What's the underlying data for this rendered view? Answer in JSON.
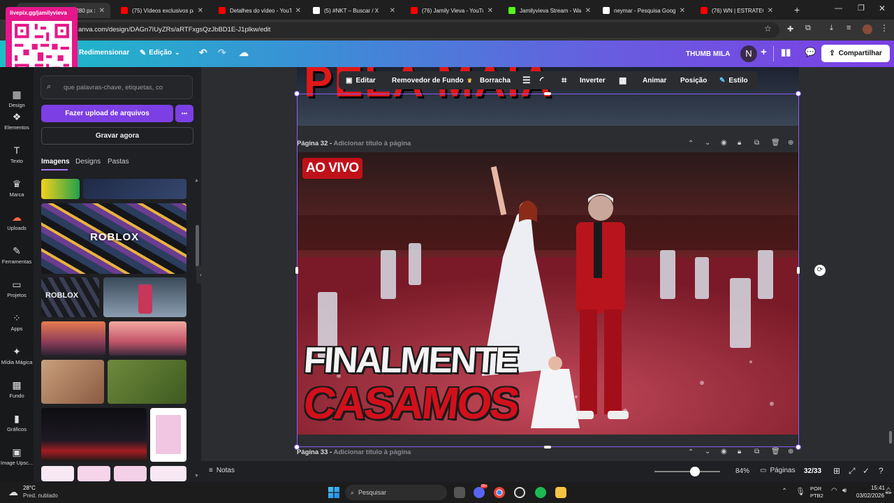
{
  "browser": {
    "tabs": [
      {
        "label": "THUMB MILA - 1280 px x",
        "color": "#3aa0ff"
      },
      {
        "label": "(75) Vídeos exclusivos par",
        "color": "#ff0000"
      },
      {
        "label": "Detalhes do vídeo - YouTu",
        "color": "#ff0000"
      },
      {
        "label": "(5) #NKT – Buscar / X",
        "color": "#ffffff"
      },
      {
        "label": "(76) Jamily Vieva - YouTu",
        "color": "#ff0000"
      },
      {
        "label": "Jamilyvieva Stream - Wat",
        "color": "#53fc18"
      },
      {
        "label": "neymar - Pesquisa Googl",
        "color": "#ffffff"
      },
      {
        "label": "(76) WN | ESTRATEGIA AL",
        "color": "#ff0000"
      }
    ],
    "url": "anva.com/design/DAGn7IUyZRs/aRTFxgsQzJbBD1E-J1plkw/edit"
  },
  "overlay": {
    "qr_label": "livepix.gg/jamilyvieva"
  },
  "header": {
    "resize": "Redimensionar",
    "edit": "Edição",
    "design_name": "THUMB MILA",
    "avatar_letter": "N",
    "share": "Compartilhar"
  },
  "rail": {
    "items": [
      {
        "label": "Design",
        "icon": "▦"
      },
      {
        "label": "Elementos",
        "icon": "❖"
      },
      {
        "label": "Texto",
        "icon": "T"
      },
      {
        "label": "Marca",
        "icon": "♛"
      },
      {
        "label": "Uploads",
        "icon": "☁"
      },
      {
        "label": "Ferramentas",
        "icon": "✎"
      },
      {
        "label": "Projetos",
        "icon": "▭"
      },
      {
        "label": "Apps",
        "icon": "⁘"
      },
      {
        "label": "Mídia Mágica",
        "icon": "✦"
      },
      {
        "label": "Fundo",
        "icon": "▩"
      },
      {
        "label": "Gráficos",
        "icon": "▮"
      },
      {
        "label": "Image Upsc...",
        "icon": "▣"
      }
    ]
  },
  "panel": {
    "search_placeholder": "que palavras-chave, etiquetas, co",
    "upload": "Fazer upload de arquivos",
    "more": "•••",
    "record": "Gravar agora",
    "tabs": [
      "Imagens",
      "Designs",
      "Pastas"
    ],
    "roblox": "ROBLOX"
  },
  "context_toolbar": {
    "edit": "Editar",
    "bg_remover": "Removedor de Fundo",
    "eraser": "Borracha",
    "flip": "Inverter",
    "animate": "Animar",
    "position": "Posição",
    "style": "Estilo"
  },
  "pages": {
    "p32_label": "Página 32 - ",
    "p32_title_placeholder": "Adicionar título à página",
    "p33_label": "Página 33 - ",
    "p33_title_placeholder": "Adicionar título à página"
  },
  "thumbnail": {
    "live_badge": "AO VIVO",
    "line1": "FINALMENTE",
    "line2": "CASAMOS",
    "prev_page_text": "PELA MAIA"
  },
  "bottom": {
    "notes": "Notas",
    "zoom": "84%",
    "pages": "Páginas",
    "page_count": "32/33",
    "zoom_fraction": 0.62
  },
  "taskbar": {
    "temp": "28°C",
    "weather": "Pred. nublado",
    "search": "Pesquisar",
    "lang1": "POR",
    "lang2": "PTB2",
    "time": "15:41",
    "date": "03/02/2026",
    "badge": "99+"
  }
}
